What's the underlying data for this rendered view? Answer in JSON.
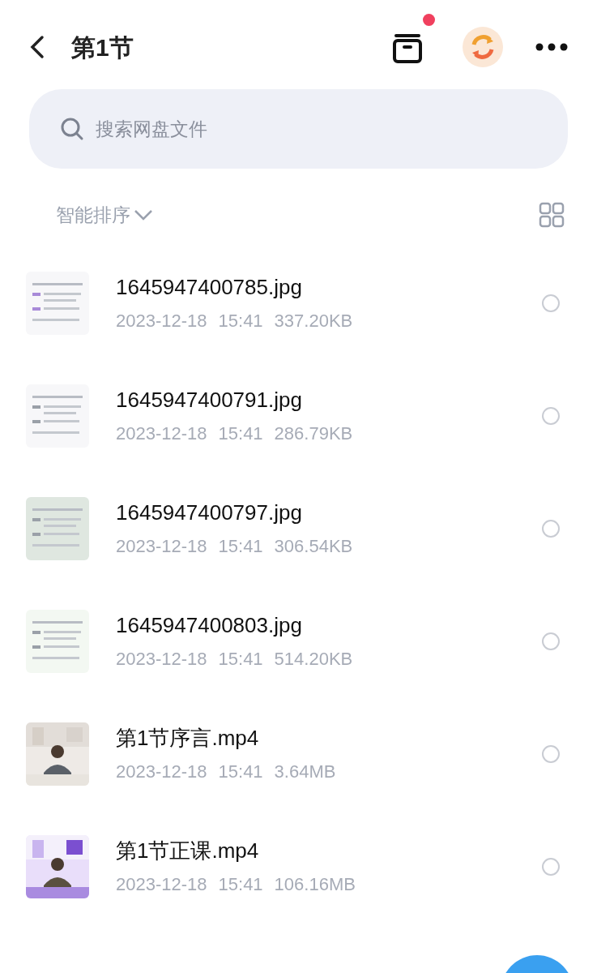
{
  "header": {
    "title": "第1节",
    "has_notification": true
  },
  "search": {
    "placeholder": "搜索网盘文件"
  },
  "sort": {
    "label": "智能排序"
  },
  "files": [
    {
      "name": "1645947400785.jpg",
      "date": "2023-12-18",
      "time": "15:41",
      "size": "337.20KB",
      "selected": false
    },
    {
      "name": "1645947400791.jpg",
      "date": "2023-12-18",
      "time": "15:41",
      "size": "286.79KB",
      "selected": false
    },
    {
      "name": "1645947400797.jpg",
      "date": "2023-12-18",
      "time": "15:41",
      "size": "306.54KB",
      "selected": false
    },
    {
      "name": "1645947400803.jpg",
      "date": "2023-12-18",
      "time": "15:41",
      "size": "514.20KB",
      "selected": false
    },
    {
      "kind": "video",
      "name": "第1节序言.mp4",
      "date": "2023-12-18",
      "time": "15:41",
      "size": "3.64MB",
      "selected": false
    },
    {
      "kind": "video",
      "name": "第1节正课.mp4",
      "date": "2023-12-18",
      "time": "15:41",
      "size": "106.16MB",
      "selected": false
    }
  ]
}
